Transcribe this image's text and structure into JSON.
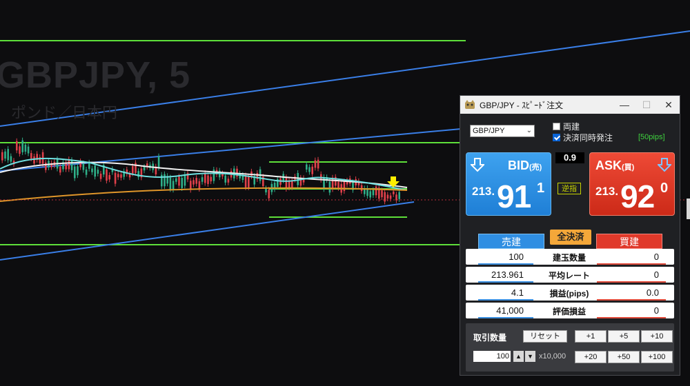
{
  "chart": {
    "symbol_title": "GBPJPY, 5",
    "symbol_sub": "ポンド／日本円"
  },
  "window": {
    "title": "GBP/JPY - ｽﾋﾟｰﾄﾞ注文",
    "symbol_value": "GBP/JPY",
    "hedge_label": "両建",
    "hedge_checked": false,
    "settle_label": "決済同時発注",
    "settle_checked": true,
    "pips_label": "[50pips]"
  },
  "quote": {
    "bid_label": "BID",
    "bid_sub": "(売)",
    "bid_prefix": "213.",
    "bid_big": "91",
    "bid_sup": "1",
    "ask_label": "ASK",
    "ask_sub": "(買)",
    "ask_prefix": "213.",
    "ask_big": "92",
    "ask_sup": "0",
    "spread": "0.9",
    "stop_label": "逆指"
  },
  "tabs": {
    "sell": "売建",
    "close_all": "全決済",
    "buy": "買建"
  },
  "positions": [
    {
      "left": "100",
      "label": "建玉数量",
      "right": "0"
    },
    {
      "left": "213.961",
      "label": "平均レート",
      "right": "0"
    },
    {
      "left": "4.1",
      "label": "損益(pips)",
      "right": "0.0"
    },
    {
      "left": "41,000",
      "label": "評価損益",
      "right": "0"
    }
  ],
  "quantity": {
    "label": "取引数量",
    "reset": "リセット",
    "value": "100",
    "multiplier": "x10,000",
    "up": "▲",
    "down": "▼",
    "steps": [
      "+1",
      "+5",
      "+10",
      "+20",
      "+50",
      "+100"
    ]
  },
  "colors": {
    "bid": "#2589e0",
    "ask": "#e0392a",
    "level_line": "#5ee03a",
    "channel_line": "#3a7fe8",
    "ma_white": "#f2f2f2",
    "ma_cyan": "#6fe0e0",
    "ma_orange": "#e0962a",
    "candle_up": "#2fb089",
    "candle_down": "#e0404a"
  }
}
